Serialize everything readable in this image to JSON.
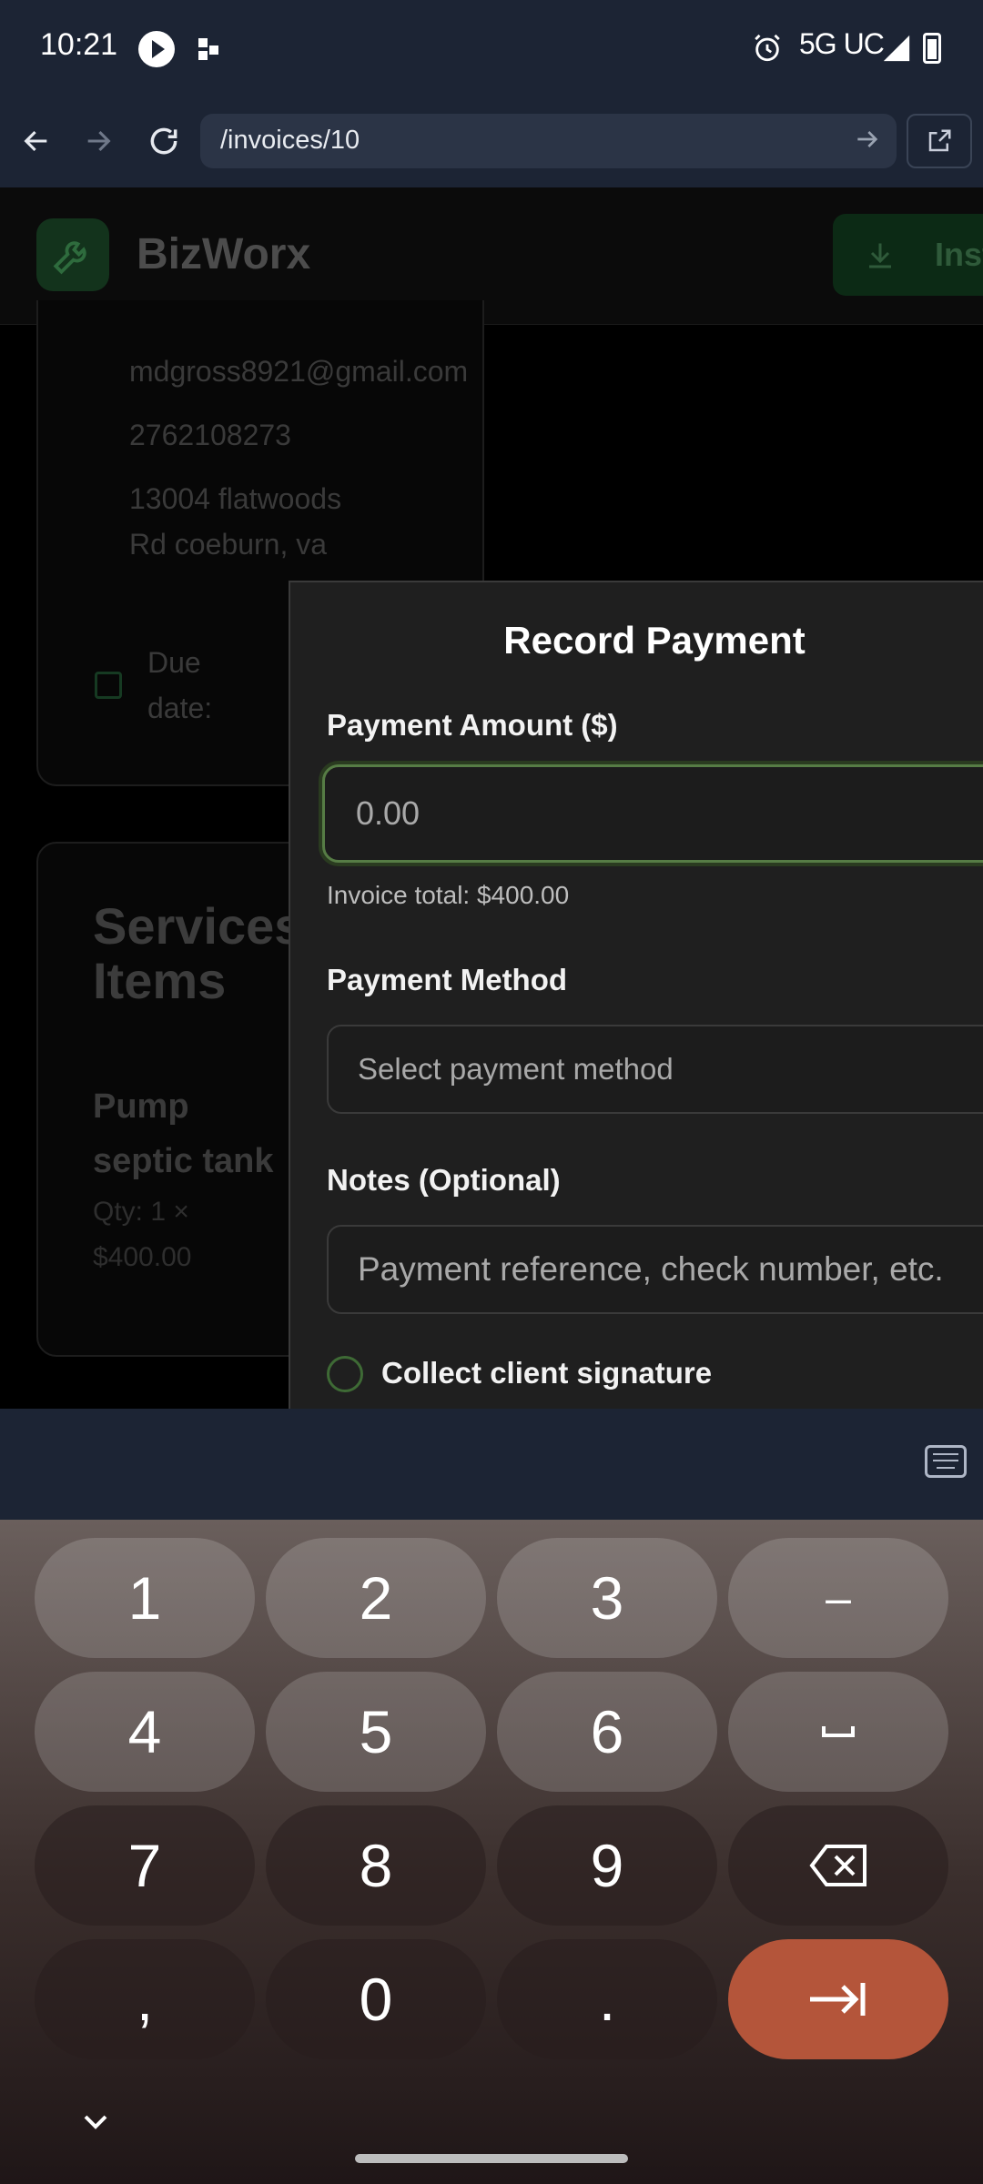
{
  "status_bar": {
    "time": "10:21",
    "network": "5G UC"
  },
  "browser": {
    "url": "/invoices/10"
  },
  "app": {
    "brand": "BizWorx",
    "install_label": "Inst"
  },
  "client": {
    "email": "mdgross8921@gmail.com",
    "phone": "2762108273",
    "address_line1": "13004 flatwoods",
    "address_line2": "Rd coeburn, va",
    "due_label_1": "Due",
    "due_label_2": "date:"
  },
  "services": {
    "heading_1": "Services",
    "heading_2": "Items",
    "item_name_1": "Pump",
    "item_name_2": "septic tank",
    "item_qty": "Qty: 1 ×",
    "item_price": "$400.00"
  },
  "modal": {
    "title": "Record Payment",
    "amount_label": "Payment Amount ($)",
    "amount_placeholder": "0.00",
    "invoice_total": "Invoice total: $400.00",
    "method_label": "Payment Method",
    "method_placeholder": "Select payment method",
    "notes_label": "Notes (Optional)",
    "notes_placeholder": "Payment reference, check number, etc.",
    "signature_label": "Collect client signature"
  },
  "keyboard": {
    "row1": [
      "1",
      "2",
      "3",
      "–"
    ],
    "row2": [
      "4",
      "5",
      "6",
      "␣"
    ],
    "row3": [
      "7",
      "8",
      "9",
      "backspace"
    ],
    "row4": [
      ",",
      "0",
      ".",
      "tab"
    ]
  },
  "colors": {
    "accent_green": "#567c45",
    "enter_key": "#b4553a"
  }
}
